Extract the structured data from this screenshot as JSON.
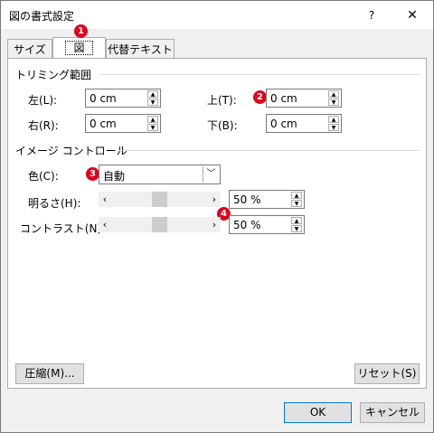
{
  "window": {
    "title": "図の書式設定",
    "help": "?",
    "close": "✕"
  },
  "tabs": [
    {
      "label": "サイズ"
    },
    {
      "label": "図"
    },
    {
      "label": "代替テキスト"
    }
  ],
  "trimming": {
    "heading": "トリミング範囲",
    "left": {
      "label": "左(L):",
      "value": "0 cm"
    },
    "top": {
      "label": "上(T):",
      "value": "0 cm"
    },
    "right": {
      "label": "右(R):",
      "value": "0 cm"
    },
    "bottom": {
      "label": "下(B):",
      "value": "0 cm"
    }
  },
  "image_control": {
    "heading": "イメージ コントロール",
    "color": {
      "label": "色(C):",
      "value": "自動"
    },
    "brightness": {
      "label": "明るさ(H):",
      "value": "50 %",
      "level": 0.5
    },
    "contrast": {
      "label": "コントラスト(N):",
      "value": "50 %",
      "level": 0.5
    }
  },
  "buttons": {
    "compress": "圧縮(M)...",
    "reset": "リセット(S)",
    "ok": "OK",
    "cancel": "キャンセル"
  },
  "annotations": [
    "1",
    "2",
    "3",
    "4"
  ],
  "colors": {
    "badge": "#e0001a",
    "accent": "#0078d7"
  }
}
